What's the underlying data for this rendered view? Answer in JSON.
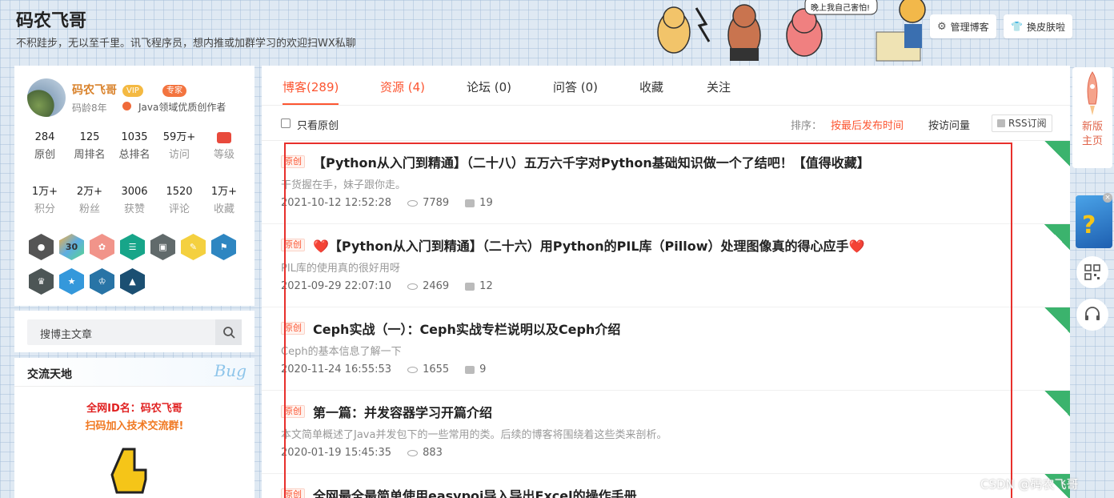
{
  "header": {
    "title": "码农飞哥",
    "subtitle": "不积跬步，无以至千里。讯飞程序员，想内推或加群学习的欢迎扫WX私聊",
    "manage_btn": "管理博客",
    "skin_btn": "换皮肤啦",
    "bubble_text": "晚上我自己害怕!"
  },
  "profile": {
    "name": "码农飞哥",
    "vip": "VIP",
    "zhuanjia": "专家",
    "age": "码龄8年",
    "cert": "Java领域优质创作者",
    "stats_row1": [
      {
        "value": "284",
        "label": "原创"
      },
      {
        "value": "125",
        "label": "周排名"
      },
      {
        "value": "1035",
        "label": "总排名"
      },
      {
        "value": "59万+",
        "label": "访问"
      },
      {
        "value": "",
        "label": "等级"
      }
    ],
    "stats_row2": [
      {
        "value": "1万+",
        "label": "积分"
      },
      {
        "value": "2万+",
        "label": "粉丝"
      },
      {
        "value": "3006",
        "label": "获赞"
      },
      {
        "value": "1520",
        "label": "评论"
      },
      {
        "value": "1万+",
        "label": "收藏"
      }
    ],
    "badge_30": "30"
  },
  "search": {
    "placeholder": "搜博主文章"
  },
  "community": {
    "title": "交流天地",
    "bug": "Bug",
    "line1": "全网ID名：码农飞哥",
    "line2": "扫码加入技术交流群!"
  },
  "tabs": [
    {
      "label": "博客(289)"
    },
    {
      "label": "资源 (4)"
    },
    {
      "label": "论坛 (0)"
    },
    {
      "label": "问答 (0)"
    },
    {
      "label": "收藏"
    },
    {
      "label": "关注"
    }
  ],
  "filter": {
    "only_original": "只看原创",
    "sort_label": "排序：",
    "sort_latest": "按最后发布时间",
    "sort_views": "按访问量",
    "rss": "RSS订阅"
  },
  "posts": [
    {
      "tag": "原创",
      "title": "【Python从入门到精通】（二十八）五万六千字对Python基础知识做一个了结吧！【值得收藏】",
      "desc": "干货握在手，妹子跟你走。",
      "date": "2021-10-12 12:52:28",
      "views": "7789",
      "comments": "19"
    },
    {
      "tag": "原创",
      "title": "❤️【Python从入门到精通】（二十六）用Python的PIL库（Pillow）处理图像真的得心应手❤️",
      "desc": "PIL库的使用真的很好用呀",
      "date": "2021-09-29 22:07:10",
      "views": "2469",
      "comments": "12"
    },
    {
      "tag": "原创",
      "title": "Ceph实战（一）：Ceph实战专栏说明以及Ceph介绍",
      "desc": "Ceph的基本信息了解一下",
      "date": "2020-11-24 16:55:53",
      "views": "1655",
      "comments": "9"
    },
    {
      "tag": "原创",
      "title": "第一篇：并发容器学习开篇介绍",
      "desc": "本文简单概述了Java并发包下的一些常用的类。后续的博客将围绕着这些类来剖析。",
      "date": "2020-01-19 15:45:35",
      "views": "883",
      "comments": ""
    },
    {
      "tag": "原创",
      "title": "全网最全最简单使用easypoi导入导出Excel的操作手册",
      "desc": "",
      "date": "",
      "views": "",
      "comments": ""
    }
  ],
  "right_bar": {
    "new_home": "新版主页"
  },
  "watermark": "CSDN @码农飞哥",
  "colors": {
    "accent": "#fc5531",
    "ribbon": "#3bb36d",
    "highlight_box": "#e8302c"
  }
}
